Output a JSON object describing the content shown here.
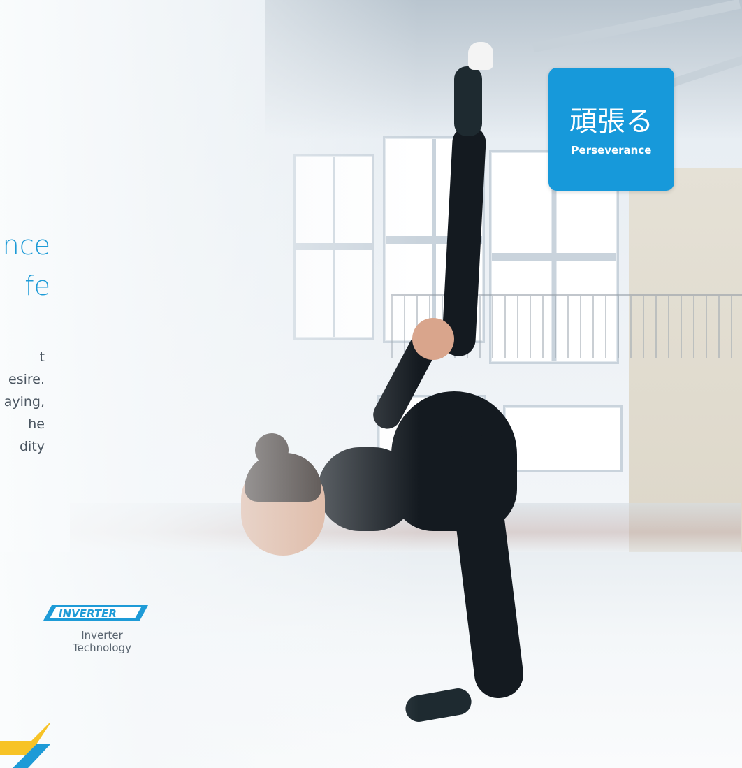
{
  "headline": {
    "line1": "nce",
    "line2": "fe"
  },
  "body_lines": [
    "t",
    "esire.",
    "aying,",
    "he",
    "dity"
  ],
  "feature": {
    "logo_text": "INVERTER",
    "caption_line1": "Inverter",
    "caption_line2": "Technology"
  },
  "badge": {
    "kanji": "頑張る",
    "label": "Perseverance"
  },
  "colors": {
    "brand_blue": "#1799da",
    "headline_blue": "#1e9bd7",
    "accent_yellow": "#f7c326"
  },
  "icons": {
    "inverter_logo": "inverter-logo-icon",
    "corner_accent": "brand-stripe-icon"
  }
}
